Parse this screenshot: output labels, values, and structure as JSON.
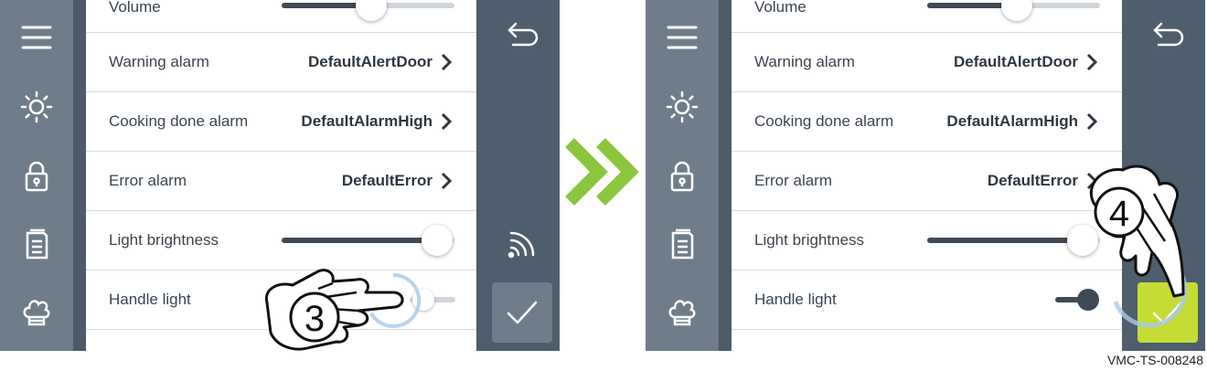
{
  "screens": [
    {
      "id": "before",
      "rows": {
        "volume": {
          "label": "Volume",
          "level": 0.52
        },
        "warning_alarm": {
          "label": "Warning alarm",
          "value": "DefaultAlertDoor"
        },
        "cooking_done_alarm": {
          "label": "Cooking done alarm",
          "value": "DefaultAlarmHigh"
        },
        "error_alarm": {
          "label": "Error alarm",
          "value": "DefaultError"
        },
        "light_brightness": {
          "label": "Light brightness",
          "level": 0.9
        },
        "handle_light": {
          "label": "Handle light",
          "state": "off"
        }
      },
      "sidebar_icons": [
        "menu-icon",
        "sun-icon",
        "lock-icon",
        "recipe-book-icon",
        "chef-hat-icon"
      ],
      "rightbar_icons": [
        "back-arrow-icon",
        "wifi-icon",
        "checkmark-icon"
      ],
      "confirm_active": false,
      "step_number": "3"
    },
    {
      "id": "after",
      "rows": {
        "volume": {
          "label": "Volume",
          "level": 0.52
        },
        "warning_alarm": {
          "label": "Warning alarm",
          "value": "DefaultAlertDoor"
        },
        "cooking_done_alarm": {
          "label": "Cooking done alarm",
          "value": "DefaultAlarmHigh"
        },
        "error_alarm": {
          "label": "Error alarm",
          "value": "DefaultError"
        },
        "light_brightness": {
          "label": "Light brightness",
          "level": 0.9
        },
        "handle_light": {
          "label": "Handle light",
          "state": "on"
        }
      },
      "sidebar_icons": [
        "menu-icon",
        "sun-icon",
        "lock-icon",
        "recipe-book-icon",
        "chef-hat-icon"
      ],
      "rightbar_icons": [
        "back-arrow-icon",
        "wifi-icon",
        "checkmark-icon"
      ],
      "confirm_active": true,
      "step_number": "4"
    }
  ],
  "colors": {
    "sidebar": "#6f7d8b",
    "rightbar": "#4f5e6c",
    "confirm_inactive": "#6f7d8b",
    "confirm_active": "#c4dc34",
    "arrow_green": "#8cc63f",
    "tap_ring": "#a9c8e8"
  },
  "caption": "VMC-TS-008248"
}
